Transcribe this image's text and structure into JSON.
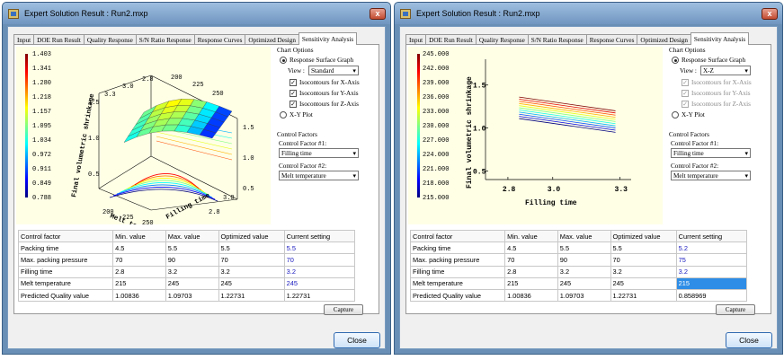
{
  "window_title": "Expert Solution Result : Run2.mxp",
  "close_glyph": "x",
  "tabs": [
    "Input",
    "DOE Run Result",
    "Quality Response",
    "S/N Ratio Response",
    "Response Curves",
    "Optimized Design",
    "Sensitivity Analysis"
  ],
  "options": {
    "chart_options_title": "Chart Options",
    "response_surface_label": "Response Surface Graph",
    "view_label": "View :",
    "isocontour_x": "Isocontours for X-Axis",
    "isocontour_y": "Isocontours for Y-Axis",
    "isocontour_z": "Isocontours for Z-Axis",
    "xy_plot_label": "X-Y Plot",
    "control_factors_title": "Control Factors",
    "control_factor_1_label": "Control Factor #1:",
    "control_factor_2_label": "Control Factor #2:"
  },
  "buttons": {
    "capture": "Capture",
    "close": "Close"
  },
  "table_headers": [
    "Control factor",
    "Min. value",
    "Max. value",
    "Optimized value",
    "Current setting"
  ],
  "panels": [
    {
      "view": "Standard",
      "isocontours_checked": true,
      "isocontours_enabled": true,
      "factor1": "Filling time",
      "factor2": "Melt temperature",
      "rows": [
        [
          "Packing time",
          "4.5",
          "5.5",
          "5.5",
          "5.5"
        ],
        [
          "Max. packing pressure",
          "70",
          "90",
          "70",
          "70"
        ],
        [
          "Filling time",
          "2.8",
          "3.2",
          "3.2",
          "3.2"
        ],
        [
          "Melt temperature",
          "215",
          "245",
          "245",
          "245"
        ],
        [
          "Predicted Quality value",
          "1.00836",
          "1.09703",
          "1.22731",
          "1.22731"
        ]
      ],
      "highlight_row": -1
    },
    {
      "view": "X-Z",
      "isocontours_checked": true,
      "isocontours_enabled": false,
      "factor1": "Filling time",
      "factor2": "Melt temperature",
      "rows": [
        [
          "Packing time",
          "4.5",
          "5.5",
          "5.5",
          "5.2"
        ],
        [
          "Max. packing pressure",
          "70",
          "90",
          "70",
          "75"
        ],
        [
          "Filling time",
          "2.8",
          "3.2",
          "3.2",
          "3.2"
        ],
        [
          "Melt temperature",
          "215",
          "245",
          "245",
          "215"
        ],
        [
          "Predicted Quality value",
          "1.00836",
          "1.09703",
          "1.22731",
          "0.858969"
        ]
      ],
      "highlight_row": 3
    }
  ],
  "chart_data": [
    {
      "type": "surface",
      "zlabel": "Final volumetric shrinkage",
      "xlabel": "Melt temperature",
      "ylabel": "Filling time",
      "colorbar_ticks": [
        "1.403",
        "1.341",
        "1.280",
        "1.218",
        "1.157",
        "1.095",
        "1.034",
        "0.972",
        "0.911",
        "0.849",
        "0.788"
      ],
      "x_ticks": [
        "200",
        "225",
        "250"
      ],
      "y_ticks": [
        "2.8",
        "3.0"
      ],
      "z_ticks": [
        "1.5",
        "1.0",
        "0.5"
      ],
      "top_ticks": [
        "3.3",
        "3.0",
        "2.8",
        "200",
        "225",
        "250"
      ],
      "right_ticks": [
        "1.5",
        "1.0",
        "0.5"
      ]
    },
    {
      "type": "line",
      "ylabel": "Final volumetric shrinkage",
      "xlabel": "Filling time",
      "colorbar_ticks": [
        "245.000",
        "242.000",
        "239.000",
        "236.000",
        "233.000",
        "230.000",
        "227.000",
        "224.000",
        "221.000",
        "218.000",
        "215.000"
      ],
      "x_ticks": [
        "2.8",
        "3.0",
        "3.3"
      ],
      "y_ticks": [
        "1.5",
        "1.0",
        "0.5"
      ],
      "x_range": [
        2.7,
        3.35
      ],
      "y_range": [
        0.4,
        1.8
      ],
      "series_x": [
        2.85,
        3.28
      ],
      "series_first_y": [
        1.36,
        1.2
      ],
      "series_step": -0.025,
      "series_count": 11
    }
  ]
}
